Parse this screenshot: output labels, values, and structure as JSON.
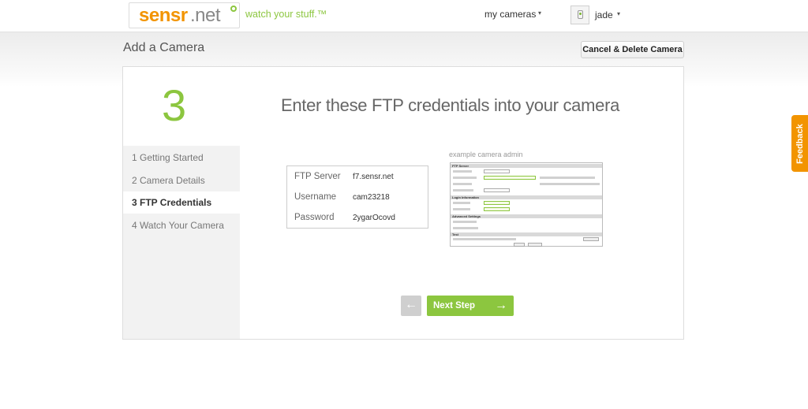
{
  "header": {
    "logo_main": "sensr",
    "logo_suffix": ".net",
    "tagline": "watch your stuff.™",
    "nav_cameras": "my cameras",
    "nav_user": "jade",
    "caret": "▾"
  },
  "page": {
    "title": "Add a Camera",
    "cancel_label": "Cancel & Delete Camera"
  },
  "wizard": {
    "current_step_number": "3",
    "heading": "Enter these FTP credentials into your camera",
    "steps": [
      {
        "label": "1  Getting Started",
        "active": false
      },
      {
        "label": "2  Camera Details",
        "active": false
      },
      {
        "label": "3  FTP Credentials",
        "active": true
      },
      {
        "label": "4  Watch Your Camera",
        "active": false
      }
    ],
    "credentials": [
      {
        "label": "FTP Server",
        "value": "f7.sensr.net"
      },
      {
        "label": "Username",
        "value": "cam23218"
      },
      {
        "label": "Password",
        "value": "2ygarOcovd"
      }
    ],
    "example_label": "example camera admin",
    "example_sections": [
      "FTP Server",
      "Login Information",
      "Advanced Settings",
      "Test"
    ],
    "back_icon": "←",
    "next_label": "Next Step",
    "next_icon": "→"
  },
  "feedback_label": "Feedback",
  "colors": {
    "accent_green": "#8cc63f",
    "brand_orange": "#f29400"
  }
}
